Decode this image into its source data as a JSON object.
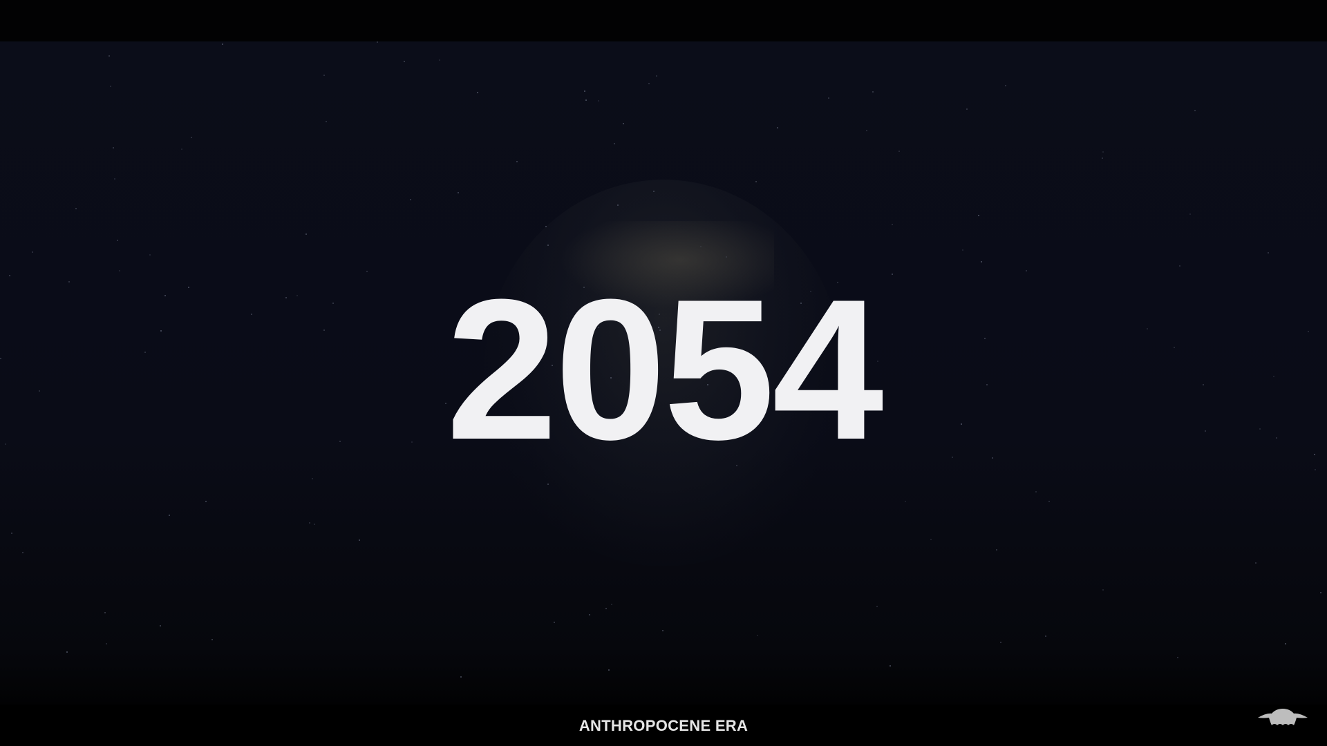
{
  "title": {
    "year": "2054"
  },
  "caption": {
    "text": "ANTHROPOCENE ERA"
  },
  "logo": {
    "icon": "creature-logo-icon",
    "color": "#bdbdbd"
  },
  "colors": {
    "background": "#0a0c17",
    "text": "#f1f1f3"
  }
}
